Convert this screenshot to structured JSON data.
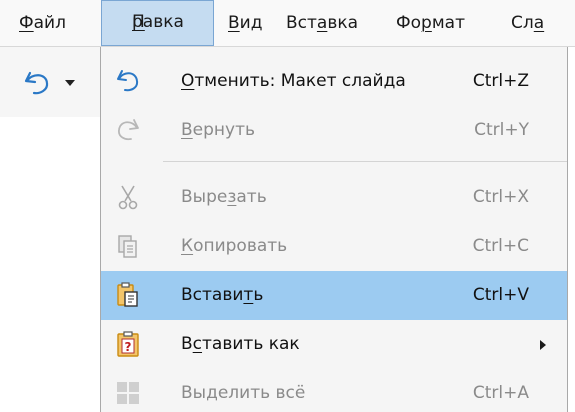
{
  "menubar": {
    "items": [
      {
        "label_pre": "",
        "label_u": "Ф",
        "label_post": "айл"
      },
      {
        "label_pre": "",
        "label_u": "П",
        "label_post": "равка"
      },
      {
        "label_pre": "",
        "label_u": "В",
        "label_post": "ид"
      },
      {
        "label_pre": "Вст",
        "label_u": "а",
        "label_post": "вка"
      },
      {
        "label_pre": "Фо",
        "label_u": "р",
        "label_post": "мат"
      },
      {
        "label_pre": "Сл",
        "label_u": "а",
        "label_post": ""
      }
    ]
  },
  "toolbar": {
    "undo_icon": "undo-icon",
    "dropdown_icon": "chevron-down-icon"
  },
  "edit_menu": {
    "items": [
      {
        "icon": "undo-icon",
        "label_pre": "",
        "label_u": "О",
        "label_post": "тменить: Макет слайда",
        "shortcut": "Ctrl+Z",
        "enabled": true,
        "highlighted": false
      },
      {
        "icon": "redo-icon",
        "label_pre": "",
        "label_u": "В",
        "label_post": "ернуть",
        "shortcut": "Ctrl+Y",
        "enabled": false,
        "highlighted": false
      },
      {
        "icon": "scissors-icon",
        "label_pre": "Выре",
        "label_u": "з",
        "label_post": "ать",
        "shortcut": "Ctrl+X",
        "enabled": false,
        "highlighted": false
      },
      {
        "icon": "copy-icon",
        "label_pre": "",
        "label_u": "К",
        "label_post": "опировать",
        "shortcut": "Ctrl+C",
        "enabled": false,
        "highlighted": false
      },
      {
        "icon": "paste-icon",
        "label_pre": "Встави",
        "label_u": "т",
        "label_post": "ь",
        "shortcut": "Ctrl+V",
        "enabled": true,
        "highlighted": true
      },
      {
        "icon": "paste-special-icon",
        "label_pre": "В",
        "label_u": "с",
        "label_post": "тавить как",
        "shortcut": "",
        "enabled": true,
        "highlighted": false,
        "submenu": true
      },
      {
        "icon": "select-all-icon",
        "label_pre": "Выделить всё",
        "label_u": "",
        "label_post": "",
        "shortcut": "Ctrl+A",
        "enabled": false,
        "highlighted": false
      }
    ]
  },
  "colors": {
    "highlight": "#9ccbf1",
    "open_menu_title": "#c5dcf1",
    "disabled_text": "#8a8a8a",
    "icon_blue": "#2a78c6",
    "icon_orange": "#e69a1e"
  }
}
